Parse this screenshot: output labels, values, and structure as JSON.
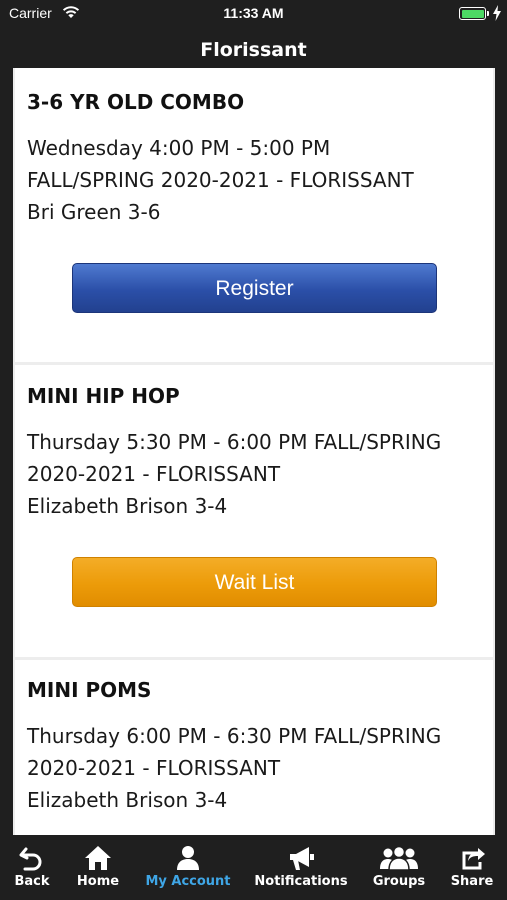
{
  "status_bar": {
    "carrier": "Carrier",
    "time": "11:33 AM"
  },
  "nav": {
    "title": "Florissant"
  },
  "classes": [
    {
      "title": "3-6 YR OLD COMBO",
      "lines": [
        "Wednesday 4:00 PM - 5:00 PM",
        "FALL/SPRING 2020-2021 - FLORISSANT",
        "Bri Green 3-6"
      ],
      "button_label": "Register"
    },
    {
      "title": "MINI HIP HOP",
      "lines": [
        "Thursday 5:30 PM - 6:00 PM FALL/SPRING",
        "2020-2021 - FLORISSANT",
        "Elizabeth Brison 3-4"
      ],
      "button_label": "Wait List"
    },
    {
      "title": "MINI POMS",
      "lines": [
        "Thursday 6:00 PM - 6:30 PM FALL/SPRING",
        "2020-2021 - FLORISSANT",
        "Elizabeth Brison 3-4"
      ]
    }
  ],
  "tabs": [
    {
      "label": "Back",
      "icon": "back-arrow-icon"
    },
    {
      "label": "Home",
      "icon": "home-icon"
    },
    {
      "label": "My Account",
      "icon": "person-icon",
      "active": true
    },
    {
      "label": "Notifications",
      "icon": "megaphone-icon"
    },
    {
      "label": "Groups",
      "icon": "group-icon"
    },
    {
      "label": "Share",
      "icon": "share-icon"
    }
  ],
  "colors": {
    "accent_active_tab": "#3fa6e6",
    "register_button": "#2b4fa8",
    "waitlist_button": "#ec9b09",
    "battery": "#4cd964"
  }
}
